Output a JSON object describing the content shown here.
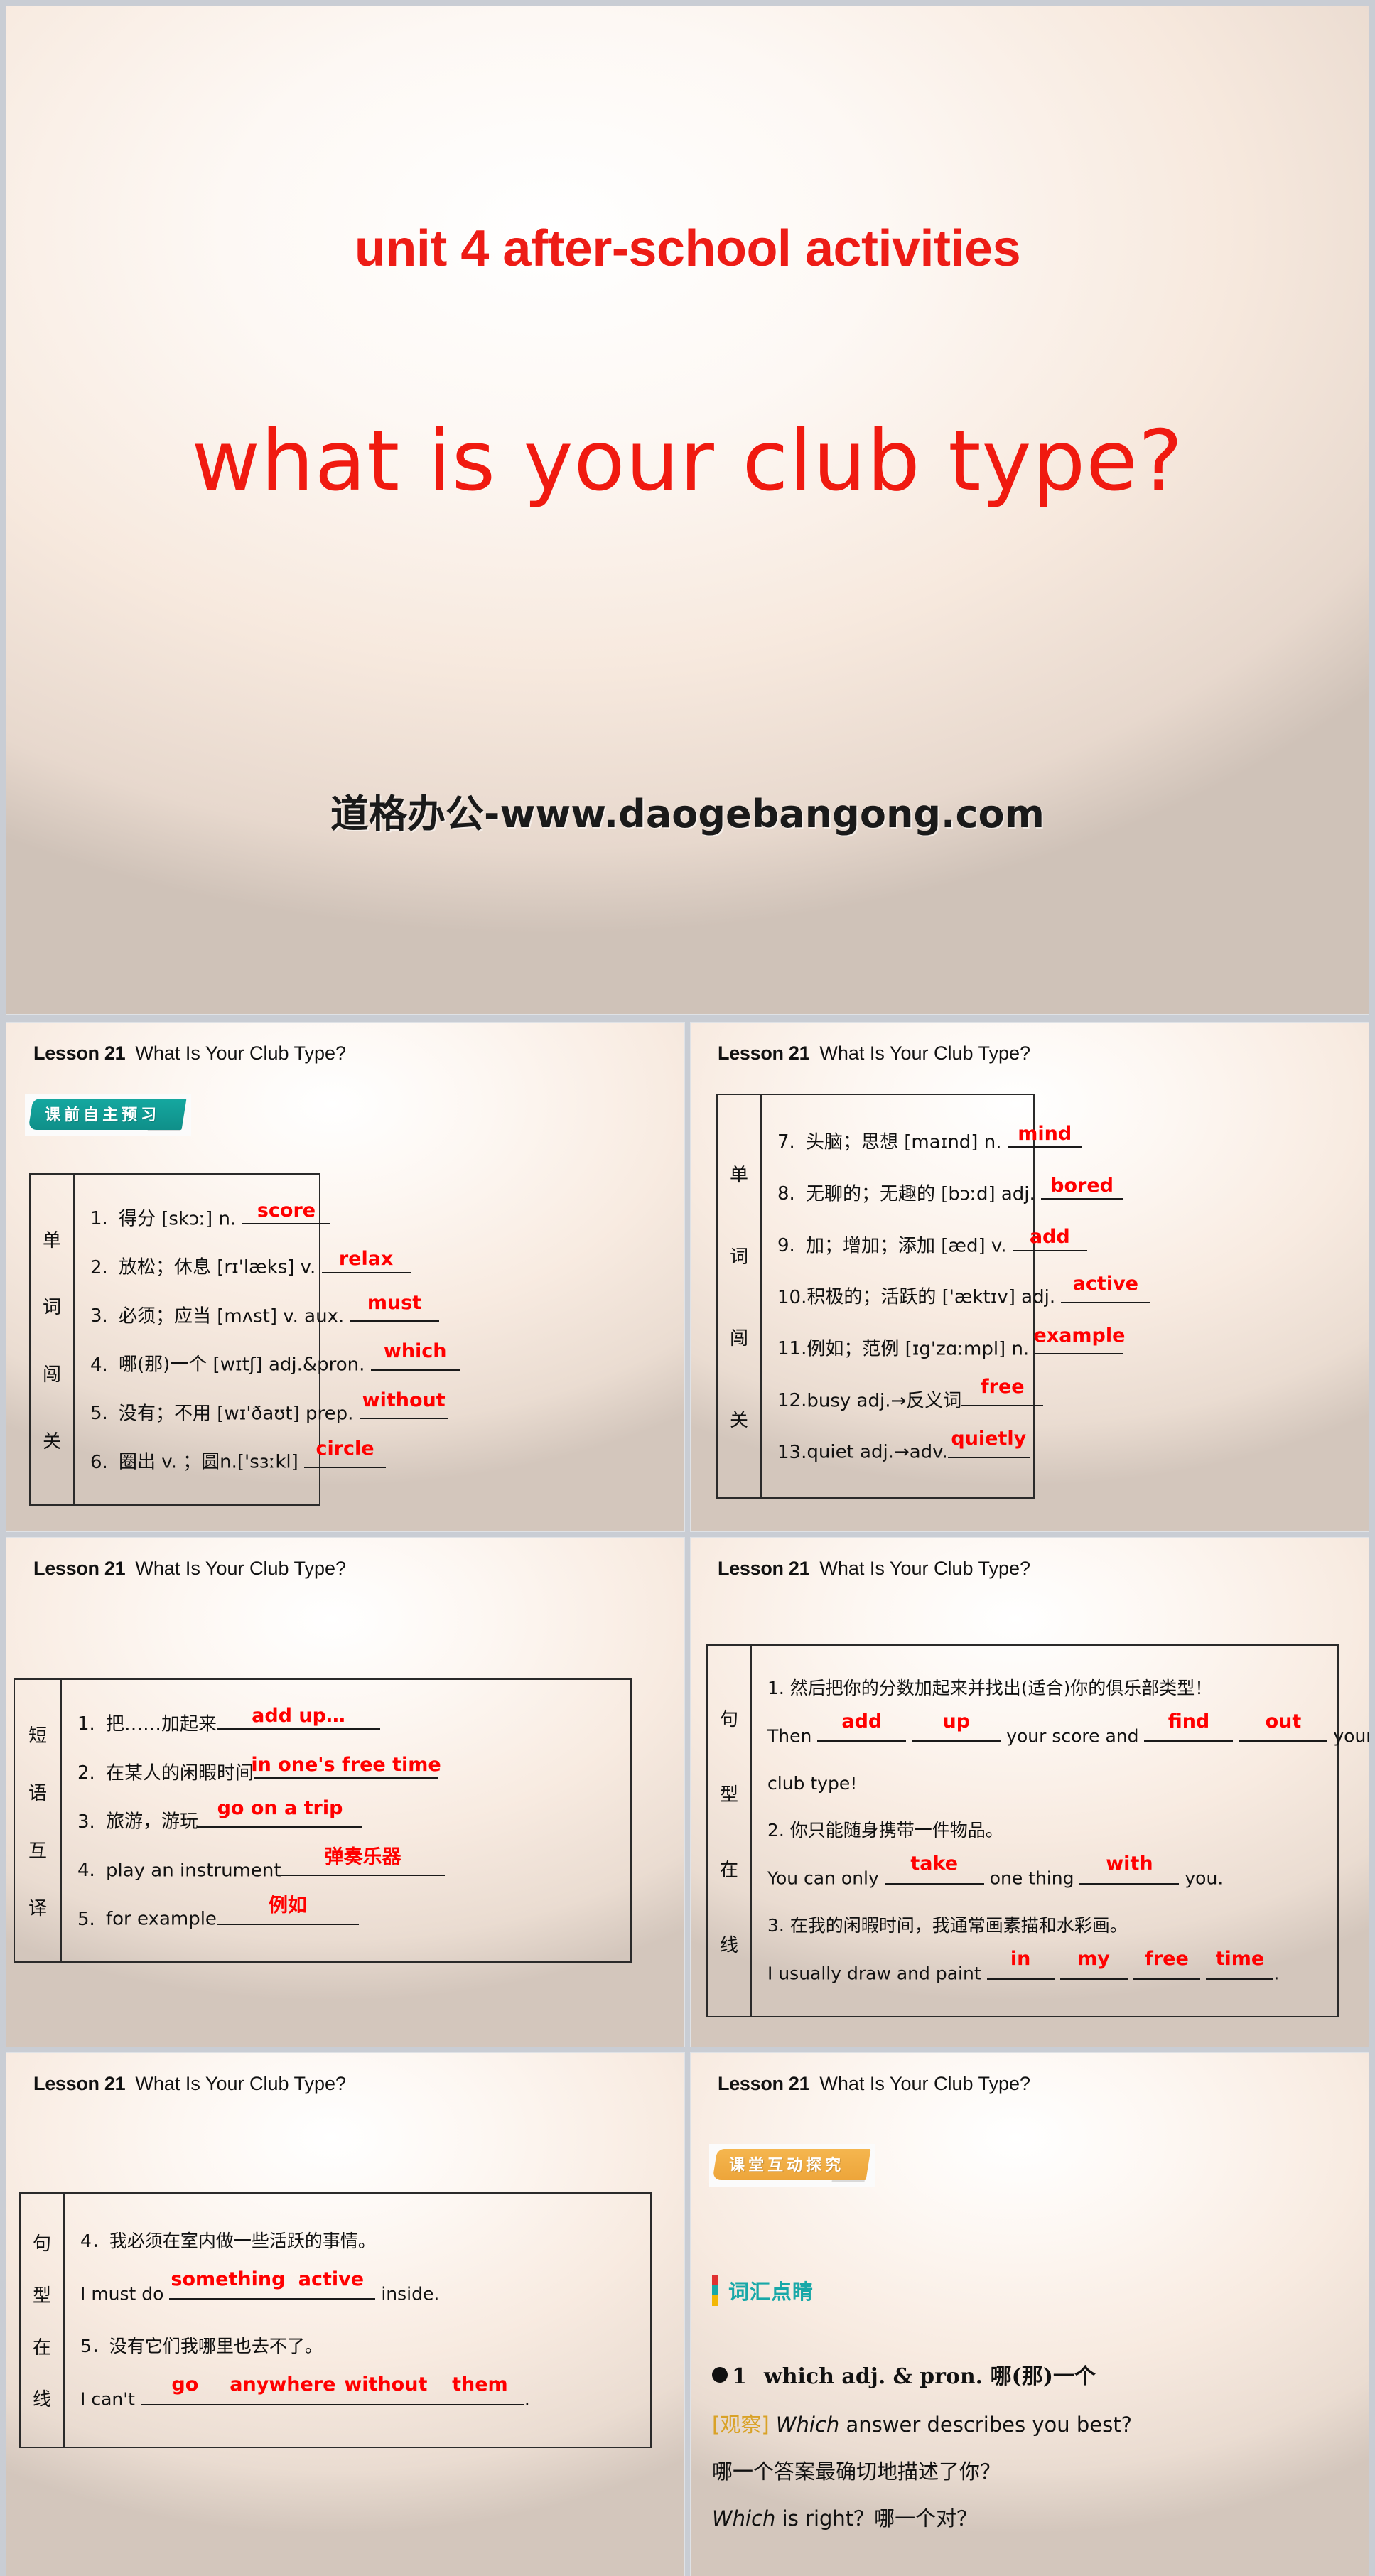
{
  "hero": {
    "unit_line": "unit 4  after-school activities",
    "title": "what is your club type?",
    "watermark": "道格办公-www.daogebangong.com",
    "title_color": "#f01a10"
  },
  "common": {
    "lesson_label": "Lesson 21",
    "lesson_title": "What Is Your Club Type?",
    "answer_color": "#ff0000"
  },
  "panels": [
    {
      "id": "panel-words-1",
      "badge": "课前自主预习",
      "badge_color": "#0f8f89",
      "side_label": [
        "单",
        "词",
        "闯",
        "关"
      ],
      "rows": [
        {
          "num": "1.",
          "text": "得分 [skɔː] n.",
          "answer": "score",
          "blank": "w150"
        },
        {
          "num": "2.",
          "text": "放松；休息 [rɪ'læks] v.",
          "answer": "relax",
          "blank": "w150"
        },
        {
          "num": "3.",
          "text": "必须；应当 [mʌst] v. aux.",
          "answer": "must",
          "blank": "w150"
        },
        {
          "num": "4.",
          "text": "哪(那)一个 [wɪtʃ] adj.&pron.",
          "answer": "which",
          "blank": "w150"
        },
        {
          "num": "5.",
          "text": "没有；不用 [wɪ'ðaʊt] prep.",
          "answer": "without",
          "blank": "w150"
        },
        {
          "num": "6.",
          "text": "圈出 v. ；圆n.['sɜːkl]",
          "answer": "circle",
          "blank": "w150"
        }
      ]
    },
    {
      "id": "panel-words-2",
      "side_label": [
        "单",
        "词",
        "闯",
        "关"
      ],
      "rows": [
        {
          "num": "7.",
          "text": "头脑；思想 [maɪnd] n.",
          "answer": "mind",
          "blank": "w140"
        },
        {
          "num": "8.",
          "text": "无聊的；无趣的 [bɔːd] adj.",
          "answer": "bored",
          "blank": "w140"
        },
        {
          "num": "9.",
          "text": "加；增加；添加 [æd] v.",
          "answer": "add",
          "blank": "w140"
        },
        {
          "num": "10.",
          "text": "积极的；活跃的 ['æktɪv] adj.",
          "answer": "active",
          "blank": "w140"
        },
        {
          "num": "11.",
          "text": "例如；范例 [ɪg'zɑːmpl] n.",
          "answer": "example",
          "blank": "w140"
        },
        {
          "num": "12.",
          "text": "busy adj.→反义词",
          "answer": "free",
          "blank": "w140"
        },
        {
          "num": "13.",
          "text": "quiet adj.→adv.",
          "answer": "quietly",
          "blank": "w140"
        }
      ]
    },
    {
      "id": "panel-phrases",
      "side_label": [
        "短",
        "语",
        "互",
        "译"
      ],
      "rows": [
        {
          "num": "1.",
          "text": "把……加起来",
          "answer": "add up…",
          "blank": "w260"
        },
        {
          "num": "2.",
          "text": "在某人的闲暇时间",
          "answer": "in one's free time",
          "blank": "w260"
        },
        {
          "num": "3.",
          "text": "旅游，游玩",
          "answer": "go on a trip",
          "blank": "w230"
        },
        {
          "num": "4.",
          "text": "play an instrument",
          "answer": "弹奏乐器",
          "blank": "w230"
        },
        {
          "num": "5.",
          "text": "for example",
          "answer": "例如",
          "blank": "w200"
        }
      ]
    },
    {
      "id": "panel-sentences-1",
      "side_label": [
        "句",
        "型",
        "在",
        "线"
      ],
      "items": [
        {
          "cn": "1.  然后把你的分数加起来并找出(适合)你的俱乐部类型！",
          "en_parts": [
            "Then ",
            " ",
            " your score and ",
            " ",
            " your"
          ],
          "answers": [
            "add",
            "up",
            "find",
            "out"
          ],
          "tail": "club type!"
        },
        {
          "cn": "2.  你只能随身携带一件物品。",
          "en_parts": [
            " You can only ",
            " one thing ",
            " you."
          ],
          "answers": [
            "take",
            "with"
          ]
        },
        {
          "cn": "3.  在我的闲暇时间，我通常画素描和水彩画。",
          "en_parts": [
            "I usually draw and paint ",
            " ",
            " ",
            " ",
            "."
          ],
          "answers": [
            "in",
            "my",
            "free",
            "time"
          ]
        }
      ]
    },
    {
      "id": "panel-sentences-2",
      "side_label": [
        "句",
        "型",
        "在",
        "线"
      ],
      "items": [
        {
          "cn": "4．我必须在室内做一些活跃的事情。",
          "en_prefix": "I must do ",
          "answers": [
            "something",
            "active"
          ],
          "tail": " inside."
        },
        {
          "cn": "5．没有它们我哪里也去不了。",
          "en_prefix": "I can't ",
          "answers": [
            "go",
            "anywhere",
            "without",
            "them"
          ],
          "tail": "."
        }
      ]
    },
    {
      "id": "panel-vocab-focus",
      "badge": "课堂互动探究",
      "badge_color": "#eda53a",
      "section_title": "词汇点睛",
      "entry_bullet": "1",
      "entry_head": "which adj. & pron. 哪(那)一个",
      "observe_tag": "[观察]",
      "lines": [
        {
          "italic": "Which",
          "rest": " answer describes you best?"
        },
        {
          "plain": "哪一个答案最确切地描述了你？"
        },
        {
          "italic": "Which",
          "rest": " is right？哪一个对？"
        }
      ]
    }
  ]
}
